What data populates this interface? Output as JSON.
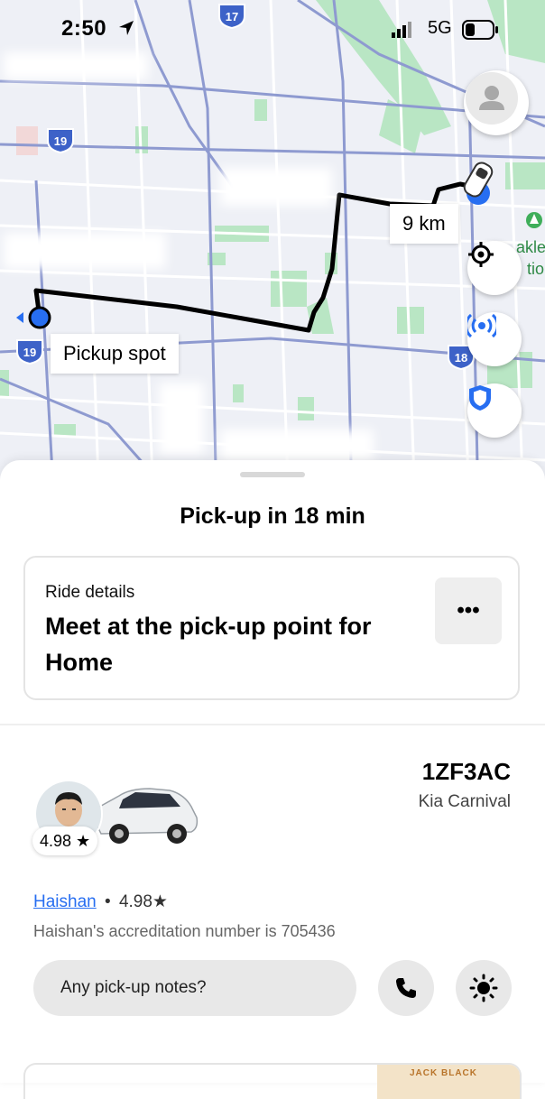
{
  "status_bar": {
    "time": "2:50",
    "network": "5G"
  },
  "map": {
    "route_distance": "9 km",
    "pickup_label": "Pickup spot",
    "highway_shields": [
      "17",
      "19",
      "19",
      "18"
    ],
    "park_label_fragment_1": "akle",
    "park_label_fragment_2": "tio"
  },
  "sheet": {
    "headline": "Pick-up in 18 min",
    "ride_details": {
      "label": "Ride details",
      "message": "Meet at the pick-up point for Home",
      "more_label": "•••"
    },
    "vehicle": {
      "plate": "1ZF3AC",
      "model": "Kia Carnival"
    },
    "driver": {
      "rating_badge": "4.98 ★",
      "name": "Haishan",
      "separator": "•",
      "rating": "4.98★",
      "accreditation": "Haishan's accreditation number is 705436"
    },
    "notes_placeholder": "Any pick-up notes?",
    "promo_text": "JACK BLACK"
  },
  "colors": {
    "accent_blue": "#276ef1",
    "route": "#000000",
    "park_green": "#b9e6c4",
    "road": "#8e9ad0"
  },
  "icons": [
    "location-arrow-icon",
    "signal-icon",
    "battery-icon",
    "profile-icon",
    "recenter-icon",
    "broadcast-icon",
    "shield-icon",
    "car-icon",
    "phone-icon",
    "brightness-icon",
    "ellipsis-icon",
    "star-icon"
  ]
}
